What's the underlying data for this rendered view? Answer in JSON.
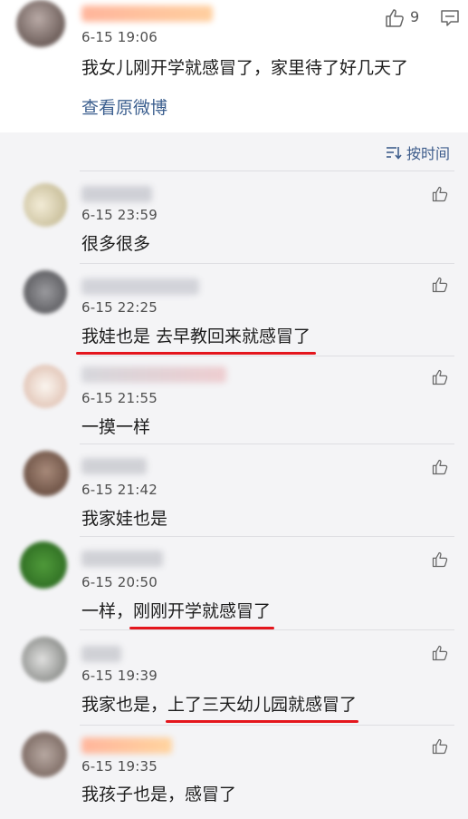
{
  "post": {
    "time": "6-15 19:06",
    "text": "我女儿刚开学就感冒了，家里待了好几天了",
    "view_original": "查看原微博",
    "like_count": "9"
  },
  "sort": {
    "label": "按时间"
  },
  "comments": [
    {
      "time": "6-15 23:59",
      "text": "很多很多"
    },
    {
      "time": "6-15 22:25",
      "text": "我娃也是 去早教回来就感冒了"
    },
    {
      "time": "6-15 21:55",
      "text": "一摸一样"
    },
    {
      "time": "6-15 21:42",
      "text": "我家娃也是"
    },
    {
      "time": "6-15 20:50",
      "text_plain": "一样，",
      "text_highlight": "刚刚开学就感冒了"
    },
    {
      "time": "6-15 19:39",
      "text_plain": "我家也是，",
      "text_highlight": "上了三天幼儿园就感冒了"
    },
    {
      "time": "6-15 19:35",
      "text": "我孩子也是，感冒了"
    }
  ],
  "colors": {
    "link": "#3c5f8f",
    "underline": "#e4161d",
    "background": "#f4f4f6"
  }
}
